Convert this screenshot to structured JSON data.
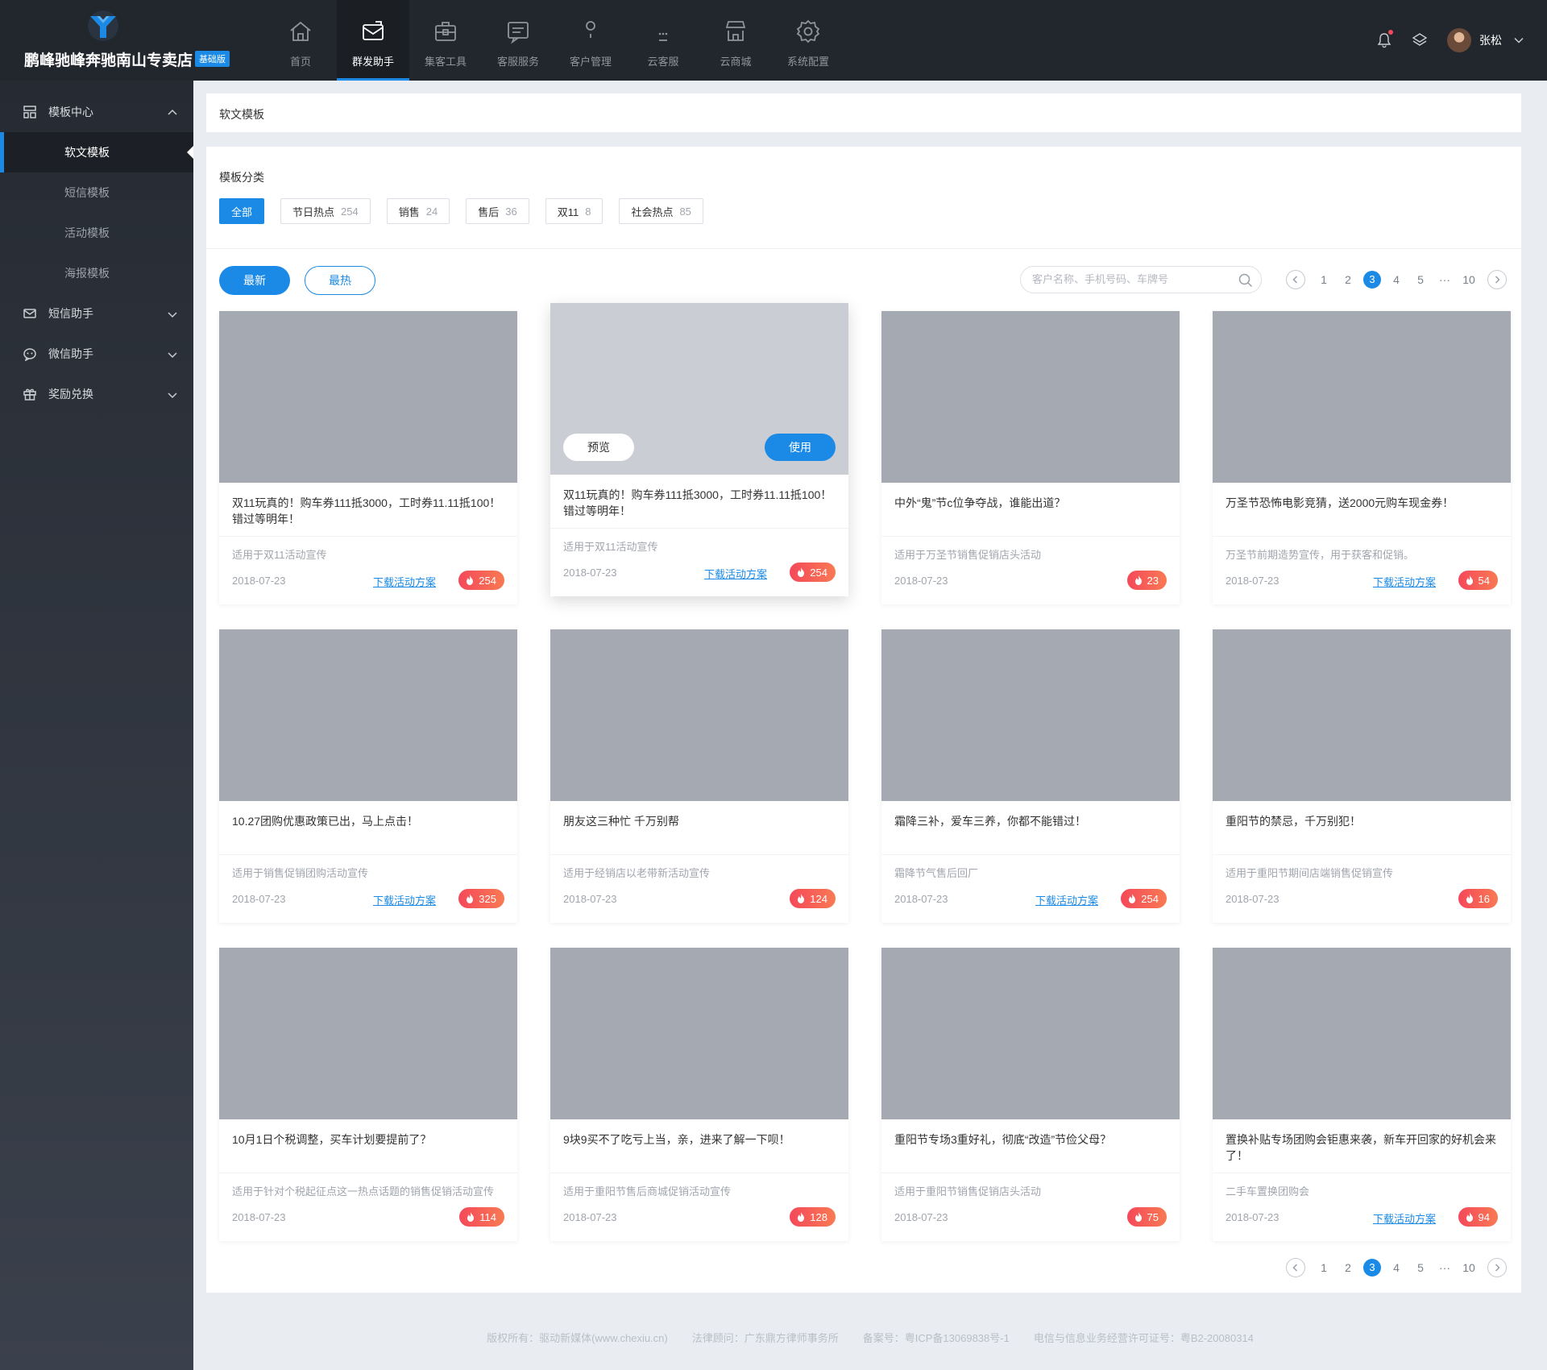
{
  "app": {
    "shop_name": "鹏峰驰峰奔驰南山专卖店",
    "plan_badge": "基础版",
    "logo_icon": "brand-y-logo",
    "accent_color": "#1a8ae6",
    "heat_color": "#f5485a"
  },
  "nav": [
    {
      "label": "首页",
      "icon": "home-icon",
      "active": false
    },
    {
      "label": "群发助手",
      "icon": "mail-icon",
      "active": true
    },
    {
      "label": "集客工具",
      "icon": "toolbox-icon",
      "active": false
    },
    {
      "label": "客服服务",
      "icon": "chat-box-icon",
      "active": false
    },
    {
      "label": "客户管理",
      "icon": "customer-icon",
      "active": false
    },
    {
      "label": "云客服",
      "icon": "cloud-service-icon",
      "active": false
    },
    {
      "label": "云商城",
      "icon": "store-icon",
      "active": false
    },
    {
      "label": "系统配置",
      "icon": "gear-icon",
      "active": false
    }
  ],
  "user": {
    "name": "张松",
    "has_notification": true
  },
  "sidebar": {
    "groups": [
      {
        "label": "模板中心",
        "icon": "template-icon",
        "expanded": true,
        "items": [
          {
            "label": "软文模板",
            "active": true
          },
          {
            "label": "短信模板",
            "active": false
          },
          {
            "label": "活动模板",
            "active": false
          },
          {
            "label": "海报模板",
            "active": false
          }
        ]
      },
      {
        "label": "短信助手",
        "icon": "envelope-icon",
        "expanded": false,
        "items": []
      },
      {
        "label": "微信助手",
        "icon": "wechat-icon",
        "expanded": false,
        "items": []
      },
      {
        "label": "奖励兑换",
        "icon": "gift-icon",
        "expanded": false,
        "items": []
      }
    ]
  },
  "breadcrumb": "软文模板",
  "filters": {
    "title": "模板分类",
    "chips": [
      {
        "label": "全部",
        "count": "",
        "active": true
      },
      {
        "label": "节日热点",
        "count": "254",
        "active": false
      },
      {
        "label": "销售",
        "count": "24",
        "active": false
      },
      {
        "label": "售后",
        "count": "36",
        "active": false
      },
      {
        "label": "双11",
        "count": "8",
        "active": false
      },
      {
        "label": "社会热点",
        "count": "85",
        "active": false
      }
    ]
  },
  "sort": {
    "newest": "最新",
    "hottest": "最热",
    "selected": "最新"
  },
  "search": {
    "placeholder": "客户名称、手机号码、车牌号",
    "value": ""
  },
  "pagination": {
    "pages": [
      "1",
      "2",
      "3",
      "4",
      "5",
      "···",
      "10"
    ],
    "current": "3"
  },
  "card_actions": {
    "preview": "预览",
    "use": "使用",
    "download": "下载活动方案"
  },
  "cards": [
    {
      "title": "双11玩真的！购车券111抵3000，工时券11.11抵100！错过等明年！",
      "desc": "适用于双11活动宣传",
      "date": "2018-07-23",
      "download": true,
      "heat": "254",
      "hover": false
    },
    {
      "title": "双11玩真的！购车券111抵3000，工时券11.11抵100！错过等明年！",
      "desc": "适用于双11活动宣传",
      "date": "2018-07-23",
      "download": true,
      "heat": "254",
      "hover": true
    },
    {
      "title": "中外“鬼”节c位争夺战，谁能出道？",
      "desc": "适用于万圣节销售促销店头活动",
      "date": "2018-07-23",
      "download": false,
      "heat": "23",
      "hover": false
    },
    {
      "title": "万圣节恐怖电影竞猜，送2000元购车现金券！",
      "desc": "万圣节前期造势宣传，用于获客和促销。",
      "date": "2018-07-23",
      "download": true,
      "heat": "54",
      "hover": false
    },
    {
      "title": "10.27团购优惠政策已出，马上点击！",
      "desc": "适用于销售促销团购活动宣传",
      "date": "2018-07-23",
      "download": true,
      "heat": "325",
      "hover": false
    },
    {
      "title": "朋友这三种忙 千万别帮",
      "desc": "适用于经销店以老带新活动宣传",
      "date": "2018-07-23",
      "download": false,
      "heat": "124",
      "hover": false
    },
    {
      "title": "霜降三补，爱车三养，你都不能错过！",
      "desc": "霜降节气售后回厂",
      "date": "2018-07-23",
      "download": true,
      "heat": "254",
      "hover": false
    },
    {
      "title": "重阳节的禁忌，千万别犯！",
      "desc": "适用于重阳节期间店端销售促销宣传",
      "date": "2018-07-23",
      "download": false,
      "heat": "16",
      "hover": false
    },
    {
      "title": "10月1日个税调整，买车计划要提前了？",
      "desc": "适用于针对个税起征点这一热点话题的销售促销活动宣传",
      "date": "2018-07-23",
      "download": false,
      "heat": "114",
      "hover": false
    },
    {
      "title": "9块9买不了吃亏上当，亲，进来了解一下呗！",
      "desc": "适用于重阳节售后商城促销活动宣传",
      "date": "2018-07-23",
      "download": false,
      "heat": "128",
      "hover": false
    },
    {
      "title": "重阳节专场3重好礼，彻底“改造”节俭父母？",
      "desc": "适用于重阳节销售促销店头活动",
      "date": "2018-07-23",
      "download": false,
      "heat": "75",
      "hover": false
    },
    {
      "title": "置换补贴专场团购会钜惠来袭，新车开回家的好机会来了！",
      "desc": "二手车置换团购会",
      "date": "2018-07-23",
      "download": true,
      "heat": "94",
      "hover": false
    }
  ],
  "footer": {
    "copyright": "版权所有：驱动新媒体(www.chexiu.cn)",
    "legal": "法律顾问：广东鼎方律师事务所",
    "icp": "备案号：粤ICP备13069838号-1",
    "license": "电信与信息业务经营许可证号：粤B2-20080314"
  }
}
